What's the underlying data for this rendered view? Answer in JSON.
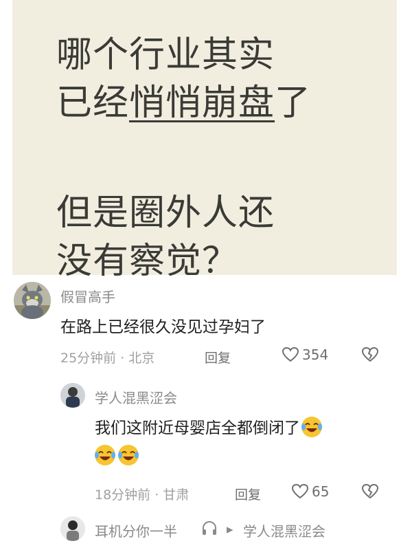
{
  "poster": {
    "line1": "哪个行业其实",
    "line2_a": "已经",
    "line2_b": "悄悄崩盘",
    "line2_c": "了",
    "line3": "但是圈外人还",
    "line4": "没有察觉？"
  },
  "comments": [
    {
      "username": "假冒高手",
      "text": "在路上已经很久没见过孕妇了",
      "time_location": "25分钟前 · 北京",
      "reply_label": "回复",
      "likes": "354"
    },
    {
      "username": "学人混黑涩会",
      "text": "我们这附近母婴店全都倒闭了",
      "emoji_name": "crying-laughing-emoji",
      "time_location": "18分钟前 · 甘肃",
      "reply_label": "回复",
      "likes": "65"
    },
    {
      "username": "耳机分你一半",
      "reply_to": "学人混黑涩会"
    }
  ],
  "colors": {
    "poster_bg": "#f1eee0",
    "text_dark": "#1f1f1f",
    "meta_gray": "#a0a0a0",
    "emoji_yellow": "#f7c531"
  }
}
